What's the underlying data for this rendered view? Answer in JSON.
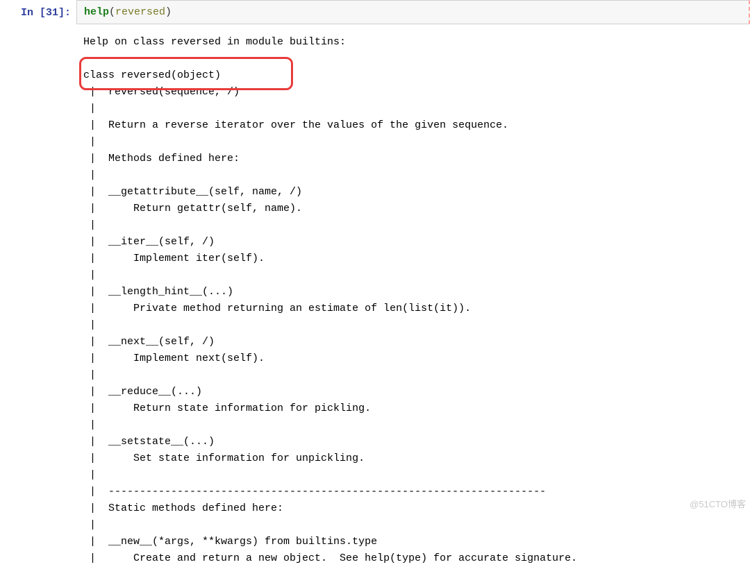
{
  "prompt": {
    "label": "In [31]:"
  },
  "code": {
    "fn": "help",
    "open": "(",
    "arg": "reversed",
    "close": ")"
  },
  "output": {
    "header": "Help on class reversed in module builtins:",
    "class_line": "class reversed(object)",
    "sig_line": " |  reversed(sequence, /)",
    "body": " |\n |  Return a reverse iterator over the values of the given sequence.\n |\n |  Methods defined here:\n |\n |  __getattribute__(self, name, /)\n |      Return getattr(self, name).\n |\n |  __iter__(self, /)\n |      Implement iter(self).\n |\n |  __length_hint__(...)\n |      Private method returning an estimate of len(list(it)).\n |\n |  __next__(self, /)\n |      Implement next(self).\n |\n |  __reduce__(...)\n |      Return state information for pickling.\n |\n |  __setstate__(...)\n |      Set state information for unpickling.\n |\n |  ----------------------------------------------------------------------\n |  Static methods defined here:\n |\n |  __new__(*args, **kwargs) from builtins.type\n |      Create and return a new object.  See help(type) for accurate signature."
  },
  "watermark": "@51CTO博客"
}
